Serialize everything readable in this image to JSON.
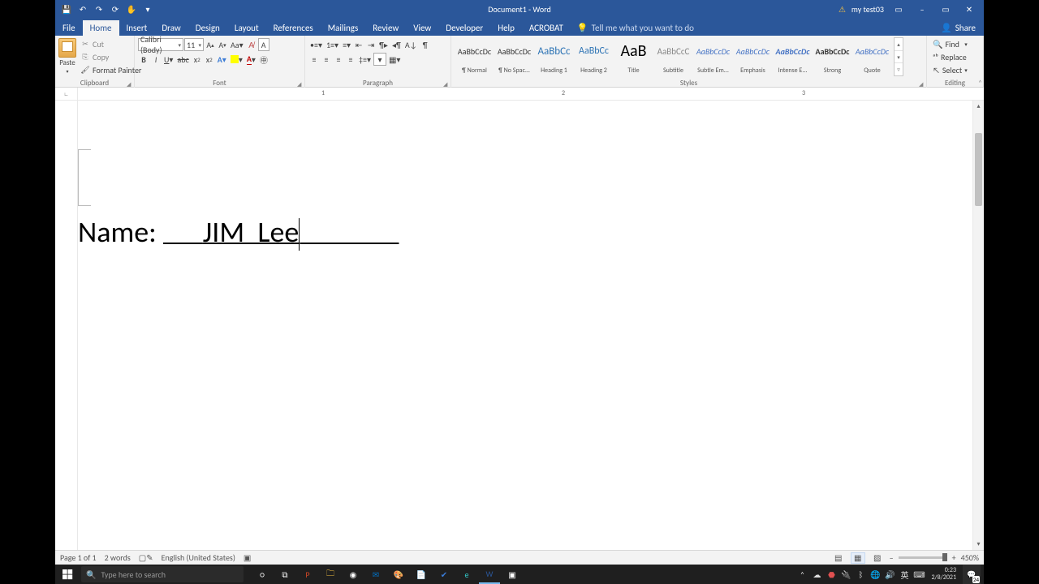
{
  "title": "Document1  -  Word",
  "user": {
    "warn_icon": "⚠",
    "name": "my test03"
  },
  "win_buttons": {
    "ribbon_opts": "▭",
    "min": "–",
    "max": "▭",
    "close": "✕"
  },
  "qat": {
    "save": "💾",
    "undo": "↶",
    "redo": "↷",
    "quick": "⟳",
    "touch": "✋",
    "more": "▾"
  },
  "tabs": [
    "File",
    "Home",
    "Insert",
    "Draw",
    "Design",
    "Layout",
    "References",
    "Mailings",
    "Review",
    "View",
    "Developer",
    "Help",
    "ACROBAT"
  ],
  "active_tab": "Home",
  "tell_me": "Tell me what you want to do",
  "share": "Share",
  "clipboard": {
    "paste": "Paste",
    "cut": "Cut",
    "copy": "Copy",
    "format_painter": "Format Painter",
    "label": "Clipboard"
  },
  "font": {
    "name": "Calibri (Body)",
    "size": "11",
    "grow": "A▴",
    "shrink": "A▾",
    "case": "Aa▾",
    "clear": "A",
    "bold": "B",
    "italic": "I",
    "underline": "U",
    "strike": "abc",
    "sub": "x₂",
    "sup": "x²",
    "effects": "A▾",
    "highlight": "ab",
    "color": "A",
    "label": "Font"
  },
  "paragraph": {
    "label": "Paragraph"
  },
  "styles": {
    "label": "Styles",
    "items": [
      {
        "preview": "AaBbCcDc",
        "name": "¶ Normal",
        "cls": ""
      },
      {
        "preview": "AaBbCcDc",
        "name": "¶ No Spac...",
        "cls": ""
      },
      {
        "preview": "AaBbCc",
        "name": "Heading 1",
        "cls": "h1"
      },
      {
        "preview": "AaBbCc",
        "name": "Heading 2",
        "cls": "h2"
      },
      {
        "preview": "AaB",
        "name": "Title",
        "cls": "title"
      },
      {
        "preview": "AaBbCcC",
        "name": "Subtitle",
        "cls": "sub"
      },
      {
        "preview": "AaBbCcDc",
        "name": "Subtle Em...",
        "cls": "i"
      },
      {
        "preview": "AaBbCcDc",
        "name": "Emphasis",
        "cls": "i"
      },
      {
        "preview": "AaBbCcDc",
        "name": "Intense E...",
        "cls": "ib"
      },
      {
        "preview": "AaBbCcDc",
        "name": "Strong",
        "cls": "b"
      },
      {
        "preview": "AaBbCcDc",
        "name": "Quote",
        "cls": "i"
      }
    ]
  },
  "editing": {
    "find": "Find",
    "replace": "Replace",
    "select": "Select",
    "label": "Editing"
  },
  "document": {
    "label": "Name: ",
    "underlined_before": "      ",
    "value": "JIM  Lee",
    "underlined_after": "               "
  },
  "status": {
    "page": "Page 1 of 1",
    "words": "2 words",
    "lang": "English (United States)",
    "zoom": "450%"
  },
  "taskbar": {
    "search_placeholder": "Type here to search",
    "time": "0:23",
    "date": "2/8/2021",
    "ime": "英",
    "notif_count": "24"
  }
}
